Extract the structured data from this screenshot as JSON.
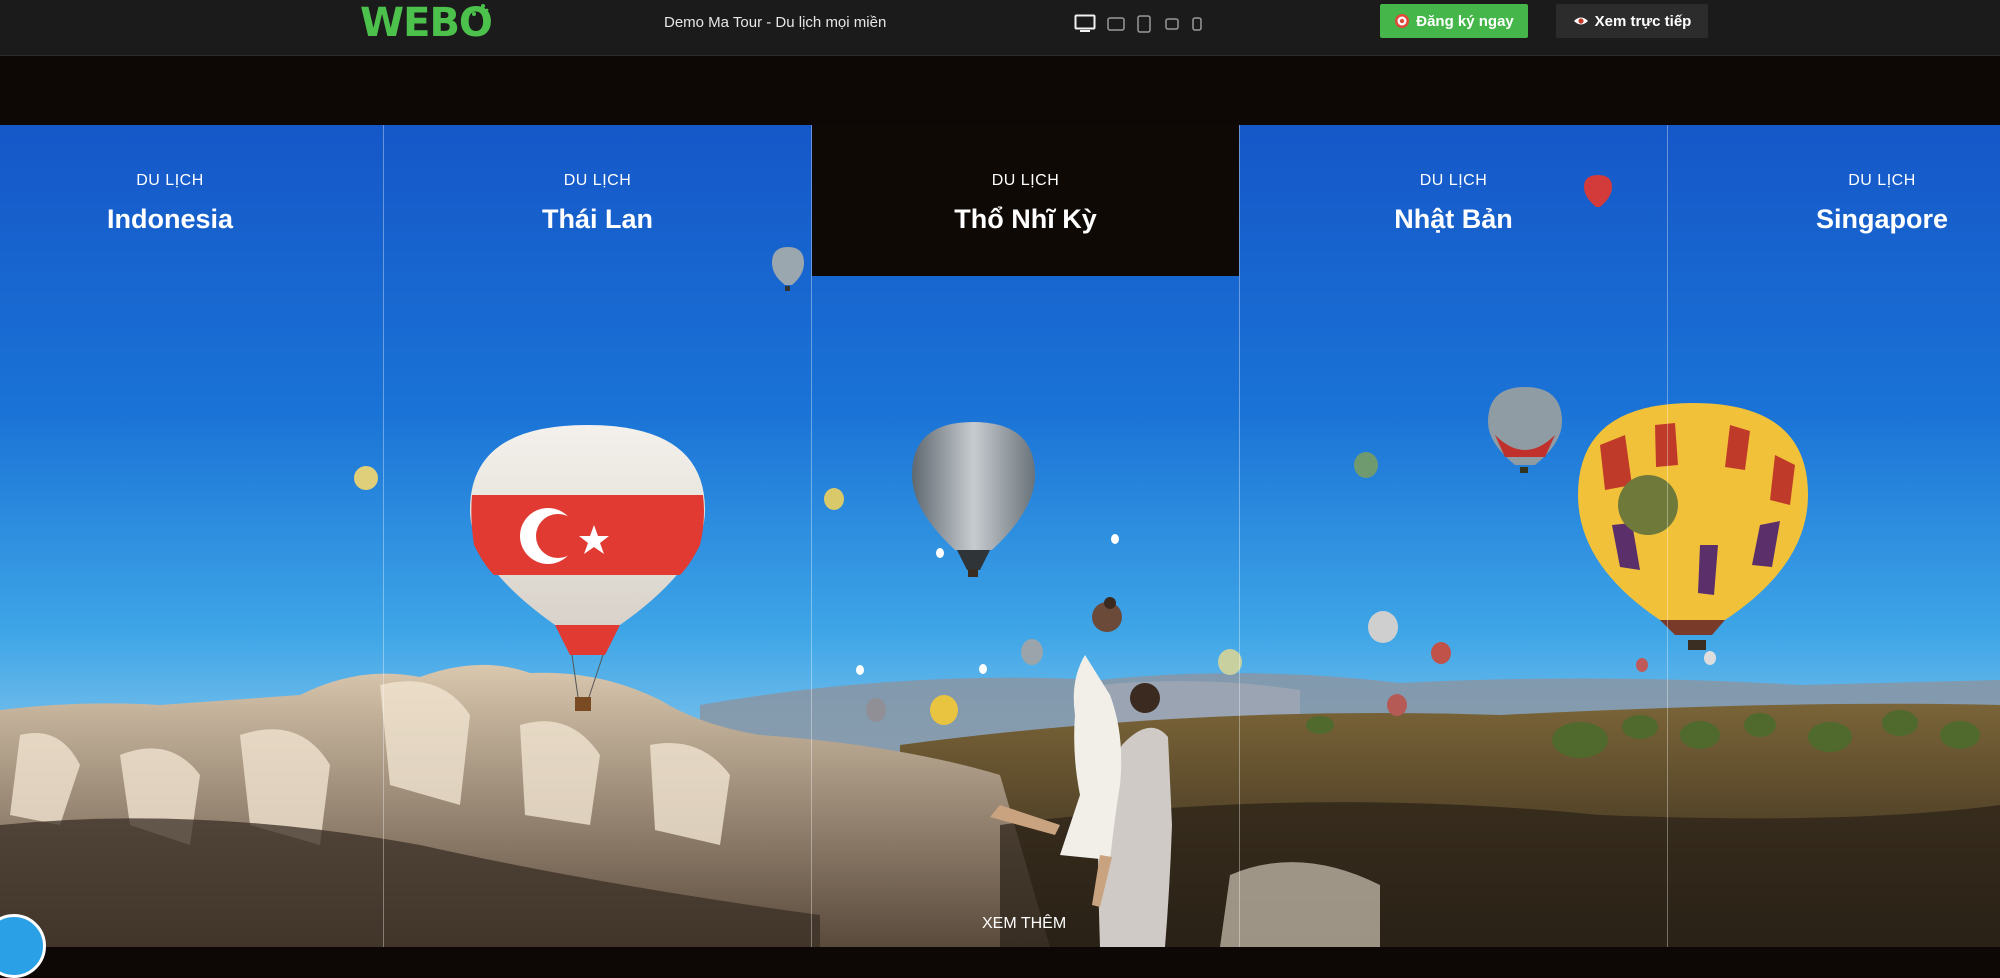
{
  "toolbar": {
    "logo_text": "WEBO",
    "site_title": "Demo Ma Tour - Du lịch mọi miền",
    "devices": [
      "desktop-icon",
      "tablet-landscape-icon",
      "tablet-portrait-icon",
      "mobile-landscape-icon",
      "mobile-portrait-icon"
    ],
    "register_label": "Đăng ký ngay",
    "live_label": "Xem trực tiếp",
    "accent_color": "#45b649"
  },
  "hero": {
    "columns": [
      {
        "sub": "DU LỊCH",
        "name": "Indonesia"
      },
      {
        "sub": "DU LỊCH",
        "name": "Thái Lan"
      },
      {
        "sub": "DU LỊCH",
        "name": "Thổ Nhĩ Kỳ",
        "active": true
      },
      {
        "sub": "DU LỊCH",
        "name": "Nhật Bản"
      },
      {
        "sub": "DU LỊCH",
        "name": "Singapore"
      }
    ],
    "more_label": "XEM THÊM"
  }
}
